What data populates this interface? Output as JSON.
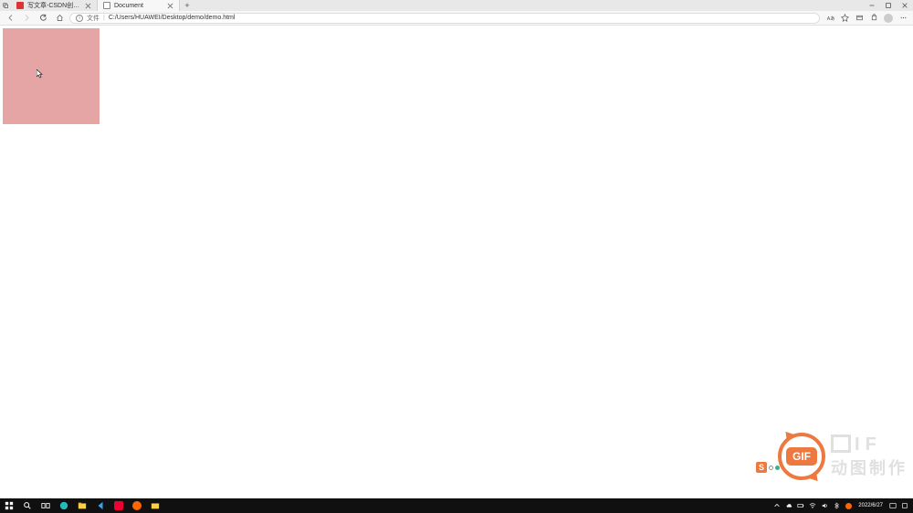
{
  "tabs": [
    {
      "title": "写文章-CSDN创作中心",
      "favicon": "csdn"
    },
    {
      "title": "Document",
      "favicon": "doc"
    }
  ],
  "address": {
    "file_label": "文件",
    "path": "C:/Users/HUAWEI/Desktop/demo/demo.html"
  },
  "watermark": {
    "badge": "GIF",
    "text_bottom": "动图制作"
  },
  "taskbar": {
    "date": "2022/6/27"
  }
}
